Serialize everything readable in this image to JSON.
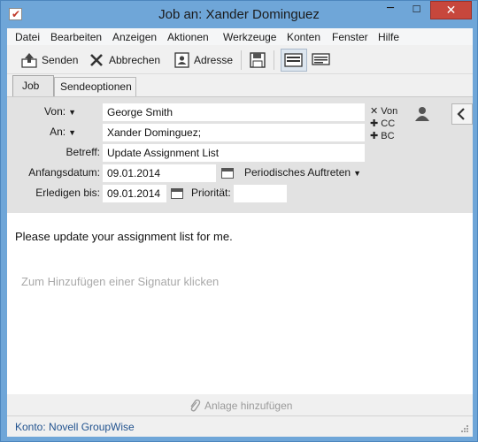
{
  "window": {
    "title": "Job an: Xander Dominguez",
    "controls": {
      "minimize": "─",
      "maximize": "☐",
      "close": "✕"
    }
  },
  "menu": [
    "Datei",
    "Bearbeiten",
    "Anzeigen",
    "Aktionen",
    "Werkzeuge",
    "Konten",
    "Fenster",
    "Hilfe"
  ],
  "toolbar": {
    "send_label": "Senden",
    "cancel_label": "Abbrechen",
    "address_label": "Adresse"
  },
  "tabs": [
    "Job",
    "Sendeoptionen"
  ],
  "form": {
    "from_label": "Von:",
    "from_value": "George Smith",
    "to_label": "An:",
    "to_value": "Xander Dominguez;",
    "subject_label": "Betreff:",
    "subject_value": "Update Assignment List",
    "start_label": "Anfangsdatum:",
    "start_value": "09.01.2014",
    "recurring_label": "Periodisches Auftreten",
    "due_label": "Erledigen bis:",
    "due_value": "09.01.2014",
    "priority_label": "Priorität:",
    "priority_value": ""
  },
  "recipients": {
    "from": "✕ Von",
    "cc": "✚ CC",
    "bc": "✚ BC"
  },
  "message": {
    "body": "Please update your assignment list for me.",
    "signature_placeholder": "Zum Hinzufügen einer Signatur klicken"
  },
  "attach_label": "Anlage hinzufügen",
  "status": "Konto: Novell GroupWise",
  "colors": {
    "window_frame": "#6fa6d8",
    "close_button": "#c7473c",
    "header_bg": "#e2e2e2",
    "status_text": "#22538f"
  }
}
